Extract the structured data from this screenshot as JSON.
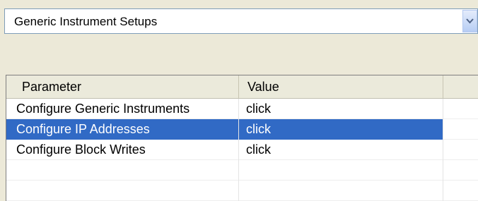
{
  "dropdown": {
    "selected": "Generic Instrument Setups",
    "icon": "chevron-down-icon"
  },
  "grid": {
    "columns": [
      "Parameter",
      "Value",
      ""
    ],
    "rows": [
      {
        "parameter": "Configure Generic Instruments",
        "value": "click",
        "selected": false
      },
      {
        "parameter": "Configure IP Addresses",
        "value": "click",
        "selected": true
      },
      {
        "parameter": "Configure Block Writes",
        "value": "click",
        "selected": false
      },
      {
        "parameter": "",
        "value": "",
        "selected": false
      },
      {
        "parameter": "",
        "value": "",
        "selected": false
      }
    ]
  },
  "colors": {
    "selection": "#316ac5",
    "window_bg": "#ece9d8",
    "header_bg": "#ebeadb"
  }
}
